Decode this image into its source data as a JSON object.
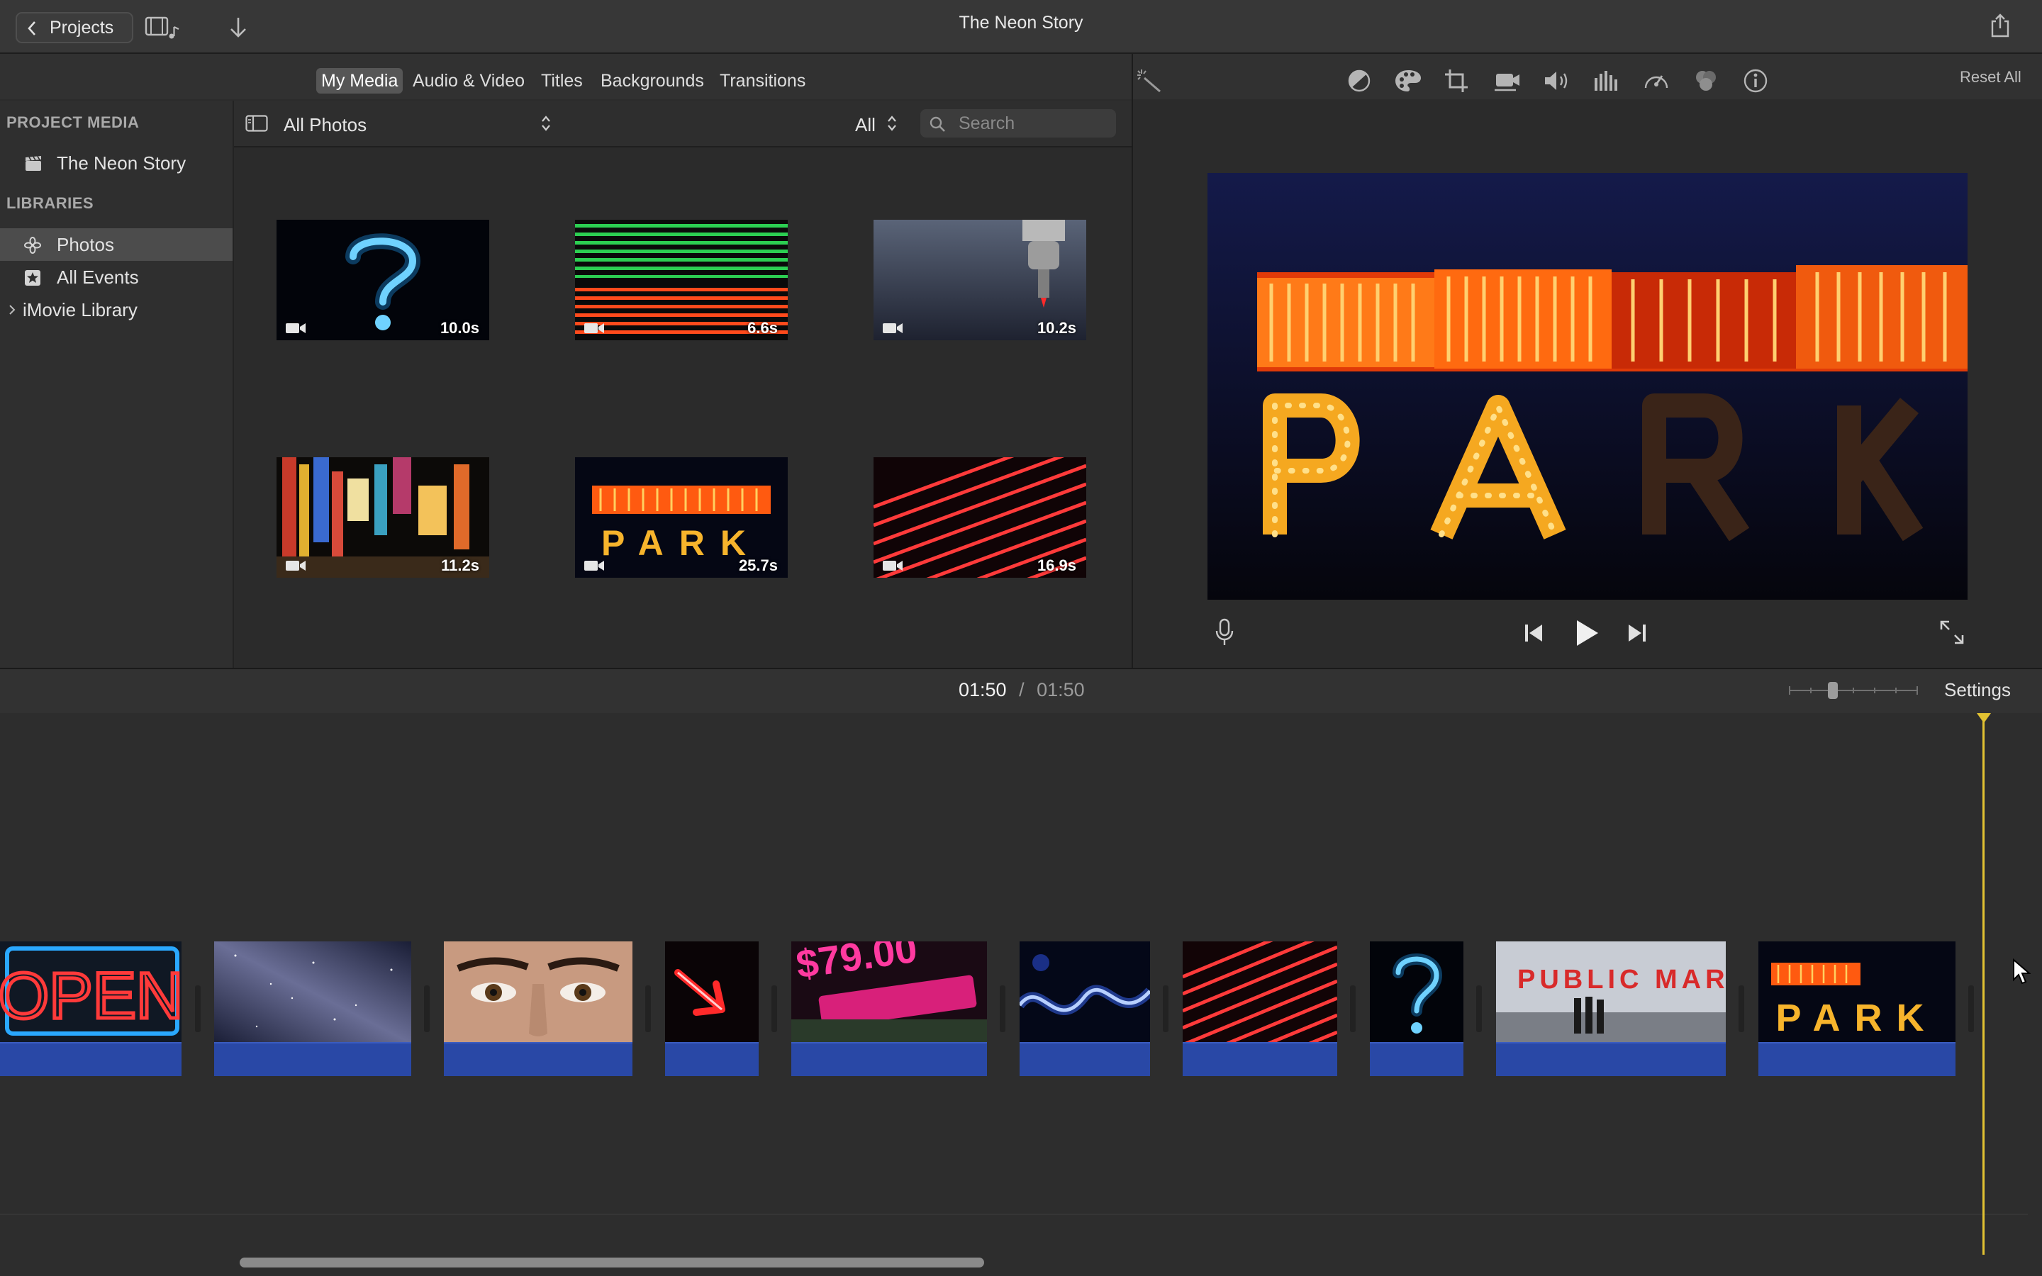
{
  "titlebar": {
    "projects_label": "Projects",
    "title": "The Neon Story"
  },
  "browser_tabs": [
    {
      "label": "My Media",
      "active": true
    },
    {
      "label": "Audio & Video",
      "active": false
    },
    {
      "label": "Titles",
      "active": false
    },
    {
      "label": "Backgrounds",
      "active": false
    },
    {
      "label": "Transitions",
      "active": false
    }
  ],
  "viewer_toolbar": {
    "icons": [
      "magic-wand-icon",
      "color-balance-icon",
      "color-correction-icon",
      "crop-icon",
      "stabilization-icon",
      "volume-icon",
      "noise-reduction-icon",
      "speed-icon",
      "clip-filter-icon",
      "info-icon"
    ],
    "reset_label": "Reset All"
  },
  "sidebar": {
    "project_media_heading": "PROJECT MEDIA",
    "project_item": "The Neon Story",
    "libraries_heading": "LIBRARIES",
    "items": [
      {
        "label": "Photos",
        "icon": "photos-icon",
        "selected": true
      },
      {
        "label": "All Events",
        "icon": "star-icon",
        "selected": false
      },
      {
        "label": "iMovie Library",
        "icon": "chevron-right-icon",
        "selected": false
      }
    ]
  },
  "filter_bar": {
    "source_label": "All Photos",
    "filter_label": "All",
    "search_placeholder": "Search"
  },
  "media": [
    {
      "subject": "blue neon question mark",
      "duration": "10.0s"
    },
    {
      "subject": "green and red neon stripes",
      "duration": "6.6s"
    },
    {
      "subject": "machine part close-up",
      "duration": "10.2s"
    },
    {
      "subject": "city street neon signs",
      "duration": "11.2s"
    },
    {
      "subject": "PARK neon sign",
      "duration": "25.7s"
    },
    {
      "subject": "red diagonal neon lines",
      "duration": "16.9s"
    }
  ],
  "viewer": {
    "frame_text": "PARK"
  },
  "timeline": {
    "current_time": "01:50",
    "separator": "/",
    "total_time": "01:50",
    "settings_label": "Settings",
    "clips": [
      {
        "subject": "OPEN neon sign",
        "text": "OPEN"
      },
      {
        "subject": "milky way night sky"
      },
      {
        "subject": "close-up of eyes"
      },
      {
        "subject": "red neon arrow"
      },
      {
        "subject": "vacancy motel sign",
        "text": "$79.00"
      },
      {
        "subject": "blue neon waves"
      },
      {
        "subject": "red neon lines"
      },
      {
        "subject": "blue neon question mark"
      },
      {
        "subject": "public market sign",
        "text": "PUBLIC MARKET"
      },
      {
        "subject": "PARK neon sign",
        "text": "PARK"
      }
    ]
  },
  "colors": {
    "selection_blue": "#2948a6",
    "playhead": "#e2c232",
    "neon_orange": "#ff6a10",
    "bulb_yellow": "#f7b42c"
  }
}
